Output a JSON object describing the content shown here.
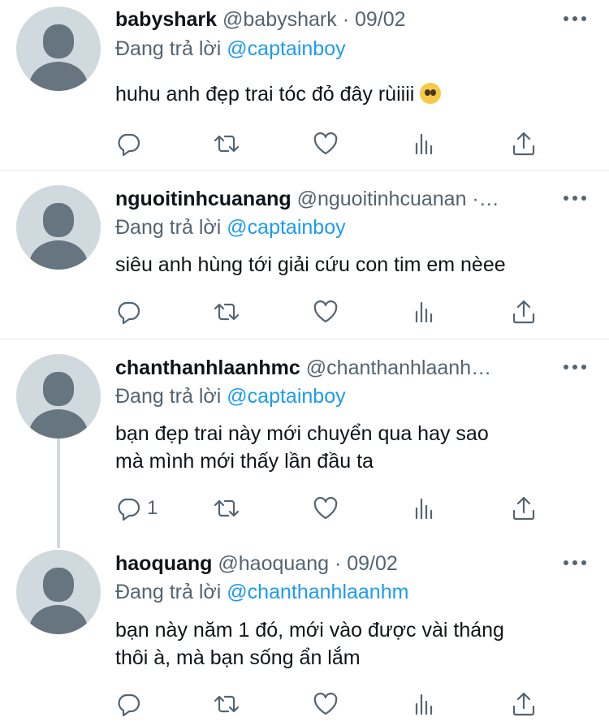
{
  "tweets": [
    {
      "name": "babyshark",
      "handle": "@babyshark",
      "sep": "·",
      "date": "09/02",
      "reply_prefix": "Đang trả lời",
      "reply_to": "@captainboy",
      "text": "huhu anh đẹp trai tóc đỏ đây rùiiii",
      "emoji": "pleading-face-emoji",
      "reply_count": ""
    },
    {
      "name": "nguoitinhcuanang",
      "handle": "@nguoitinhcuanan",
      "sep": "·…",
      "date": "",
      "reply_prefix": "Đang trả lời",
      "reply_to": "@captainboy",
      "text": "siêu anh hùng tới giải cứu con tim em nèee",
      "reply_count": ""
    },
    {
      "name": "chanthanhlaanhmc",
      "handle": "@chanthanhlaanh…",
      "sep": "",
      "date": "",
      "reply_prefix": "Đang trả lời",
      "reply_to": "@captainboy",
      "text_line1": "bạn đẹp trai này mới chuyển qua hay sao",
      "text_line2": "mà mình mới thấy lần đầu ta",
      "reply_count": "1"
    },
    {
      "name": "haoquang",
      "handle": "@haoquang",
      "sep": "·",
      "date": "09/02",
      "reply_prefix": "Đang trả lời",
      "reply_to": "@chanthanhlaanhm",
      "text_line1": "bạn này năm 1 đó, mới vào được vài tháng",
      "text_line2": "thôi à, mà bạn sống ẩn lắm",
      "reply_count": ""
    }
  ],
  "icons": [
    "reply-icon",
    "retweet-icon",
    "like-icon",
    "analytics-icon",
    "share-icon",
    "more-icon"
  ],
  "colors": {
    "link": "#1d9bf0",
    "muted": "#536471",
    "text": "#0f1419",
    "avatar_bg": "#cfd9de"
  }
}
